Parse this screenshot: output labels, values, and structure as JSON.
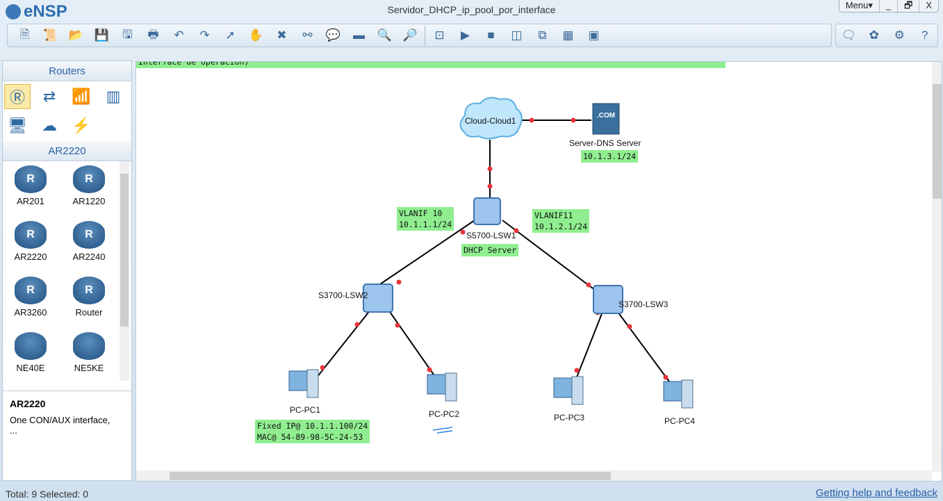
{
  "app": {
    "name": "eNSP",
    "title": "Servidor_DHCP_ip_pool_por_interface"
  },
  "window": {
    "menu": "Menu▾",
    "minimize": "_",
    "restore": "🗗",
    "close": "X"
  },
  "toolbar": [
    {
      "icon": "new-topology-icon",
      "g": "🗎"
    },
    {
      "icon": "new-script-icon",
      "g": "📜"
    },
    {
      "icon": "open-icon",
      "g": "📂"
    },
    {
      "icon": "save-icon",
      "g": "💾"
    },
    {
      "icon": "save-as-icon",
      "g": "🖫"
    },
    {
      "icon": "print-icon",
      "g": "🖶"
    },
    {
      "icon": "undo-icon",
      "g": "↶"
    },
    {
      "icon": "redo-icon",
      "g": "↷"
    },
    {
      "icon": "select-icon",
      "g": "➚"
    },
    {
      "icon": "pan-hand-icon",
      "g": "✋"
    },
    {
      "icon": "delete-icon",
      "g": "✖"
    },
    {
      "icon": "delete-link-icon",
      "g": "⚯"
    },
    {
      "icon": "text-note-icon",
      "g": "💬"
    },
    {
      "icon": "rectangle-icon",
      "g": "▬"
    },
    {
      "icon": "zoom-in-icon",
      "g": "🔍"
    },
    {
      "icon": "zoom-out-icon",
      "g": "🔎"
    },
    {
      "icon": "fit-icon",
      "g": "⊡"
    },
    {
      "icon": "start-icon",
      "g": "▶"
    },
    {
      "icon": "stop-icon",
      "g": "■"
    },
    {
      "icon": "capture-icon",
      "g": "◫"
    },
    {
      "icon": "topology-icon",
      "g": "⧉"
    },
    {
      "icon": "grid-icon",
      "g": "▦"
    },
    {
      "icon": "cli-icon",
      "g": "▣"
    }
  ],
  "toolbar_right": [
    {
      "icon": "feedback-icon",
      "g": "🗨"
    },
    {
      "icon": "huawei-icon",
      "g": "✿"
    },
    {
      "icon": "settings-gear-icon",
      "g": "⚙"
    },
    {
      "icon": "help-icon",
      "g": "?"
    }
  ],
  "colors": {
    "label_bg": "#90ee90",
    "link_dot": "#e8333a",
    "accent": "#2a62a6"
  },
  "sidebar": {
    "category_title": "Routers",
    "categories": [
      {
        "icon": "router-icon",
        "g": "Ⓡ"
      },
      {
        "icon": "switch-icon",
        "g": "⇄"
      },
      {
        "icon": "wireless-icon",
        "g": "📶"
      },
      {
        "icon": "firewall-icon",
        "g": "▥"
      },
      {
        "icon": "pc-icon",
        "g": "🖥"
      },
      {
        "icon": "cloud-icon",
        "g": "☁"
      },
      {
        "icon": "power-icon",
        "g": "⚡"
      }
    ],
    "model_title": "AR2220",
    "devices": [
      "AR201",
      "AR1220",
      "AR2220",
      "AR2240",
      "AR3260",
      "Router",
      "NE40E",
      "NE5KE"
    ],
    "desc_title": "AR2220",
    "desc_text": "One CON/AUX interface,",
    "desc_more": "..."
  },
  "canvas": {
    "top_note": "Interface de operación)",
    "nodes": {
      "cloud": "Cloud-Cloud1",
      "server": "Server-DNS Server",
      "core": "S5700-LSW1",
      "lsw2": "S3700-LSW2",
      "lsw3": "S3700-LSW3",
      "pc1": "PC-PC1",
      "pc2": "PC-PC2",
      "pc3": "PC-PC3",
      "pc4": "PC-PC4"
    },
    "labels": {
      "server_ip": "10.1.3.1/24",
      "vlanif10": "VLANIF 10\n10.1.1.1/24",
      "vlanif11": "VLANIF11\n10.1.2.1/24",
      "dhcp": "DHCP Server",
      "pc1": "Fixed IP@ 10.1.1.100/24\nMAC@ 54-89-98-5C-24-53"
    }
  },
  "status": {
    "text": "Total: 9  Selected: 0",
    "help": "Getting help and feedback"
  }
}
